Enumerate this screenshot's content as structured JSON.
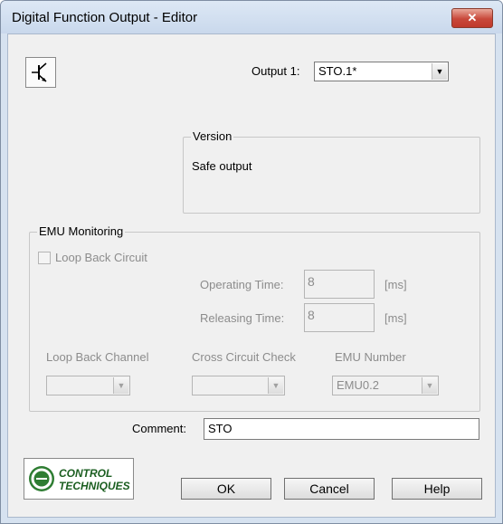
{
  "window": {
    "title": "Digital Function Output - Editor"
  },
  "output": {
    "label": "Output 1:",
    "value": "STO.1*"
  },
  "version": {
    "title": "Version",
    "text": "Safe output"
  },
  "emu": {
    "title": "EMU Monitoring",
    "loop_back_circuit": "Loop Back Circuit",
    "operating_time_label": "Operating Time:",
    "operating_time_value": "8",
    "releasing_time_label": "Releasing Time:",
    "releasing_time_value": "8",
    "unit": "[ms]",
    "loop_back_channel_label": "Loop Back Channel",
    "cross_circuit_check_label": "Cross Circuit Check",
    "emu_number_label": "EMU Number",
    "emu_number_value": "EMU0.2"
  },
  "comment": {
    "label": "Comment:",
    "value": "STO"
  },
  "buttons": {
    "ok": "OK",
    "cancel": "Cancel",
    "help": "Help"
  },
  "logo": {
    "line1": "CONTROL",
    "line2": "TECHNIQUES"
  },
  "icons": {
    "close": "close-icon",
    "output": "transistor-icon",
    "dropdown": "chevron-down-icon"
  }
}
